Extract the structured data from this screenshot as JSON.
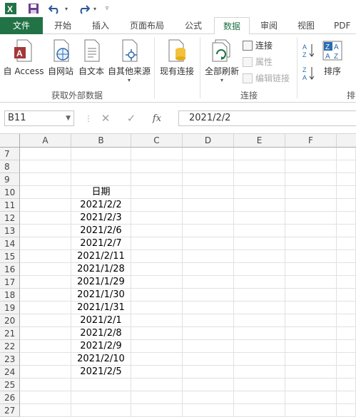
{
  "colors": {
    "brand_green": "#217346",
    "header_bg": "#f3f3f3",
    "gridline": "#e1e1e1"
  },
  "qat": {
    "icons": [
      "excel-logo-icon",
      "save-icon",
      "undo-icon",
      "redo-icon",
      "customize-icon"
    ]
  },
  "tabs": {
    "file": "文件",
    "items": [
      "开始",
      "插入",
      "页面布局",
      "公式",
      "数据",
      "审阅",
      "视图",
      "PDF工"
    ],
    "active": "数据"
  },
  "ribbon": {
    "external_data": {
      "buttons": [
        "自 Access",
        "自网站",
        "自文本",
        "自其他来源"
      ],
      "label": "获取外部数据"
    },
    "existing_connections": "现有连接",
    "connections": {
      "refresh_all": "全部刷新",
      "connections": "连接",
      "properties": "属性",
      "edit_links": "编辑链接",
      "label": "连接"
    },
    "sort": {
      "sort_label": "排序",
      "group_label": "排"
    }
  },
  "formula_bar": {
    "name_box": "B11",
    "cancel": "✕",
    "enter": "✓",
    "fx": "fx",
    "value": "2021/2/2"
  },
  "sheet": {
    "columns": [
      "A",
      "B",
      "C",
      "D",
      "E",
      "F"
    ],
    "rows": [
      {
        "num": "7",
        "b": ""
      },
      {
        "num": "8",
        "b": ""
      },
      {
        "num": "9",
        "b": ""
      },
      {
        "num": "10",
        "b": "日期"
      },
      {
        "num": "11",
        "b": "2021/2/2"
      },
      {
        "num": "12",
        "b": "2021/2/3"
      },
      {
        "num": "13",
        "b": "2021/2/6"
      },
      {
        "num": "14",
        "b": "2021/2/7"
      },
      {
        "num": "15",
        "b": "2021/2/11"
      },
      {
        "num": "16",
        "b": "2021/1/28"
      },
      {
        "num": "17",
        "b": "2021/1/29"
      },
      {
        "num": "18",
        "b": "2021/1/30"
      },
      {
        "num": "19",
        "b": "2021/1/31"
      },
      {
        "num": "20",
        "b": "2021/2/1"
      },
      {
        "num": "21",
        "b": "2021/2/8"
      },
      {
        "num": "22",
        "b": "2021/2/9"
      },
      {
        "num": "23",
        "b": "2021/2/10"
      },
      {
        "num": "24",
        "b": "2021/2/5"
      },
      {
        "num": "25",
        "b": ""
      },
      {
        "num": "26",
        "b": ""
      },
      {
        "num": "27",
        "b": ""
      }
    ]
  }
}
